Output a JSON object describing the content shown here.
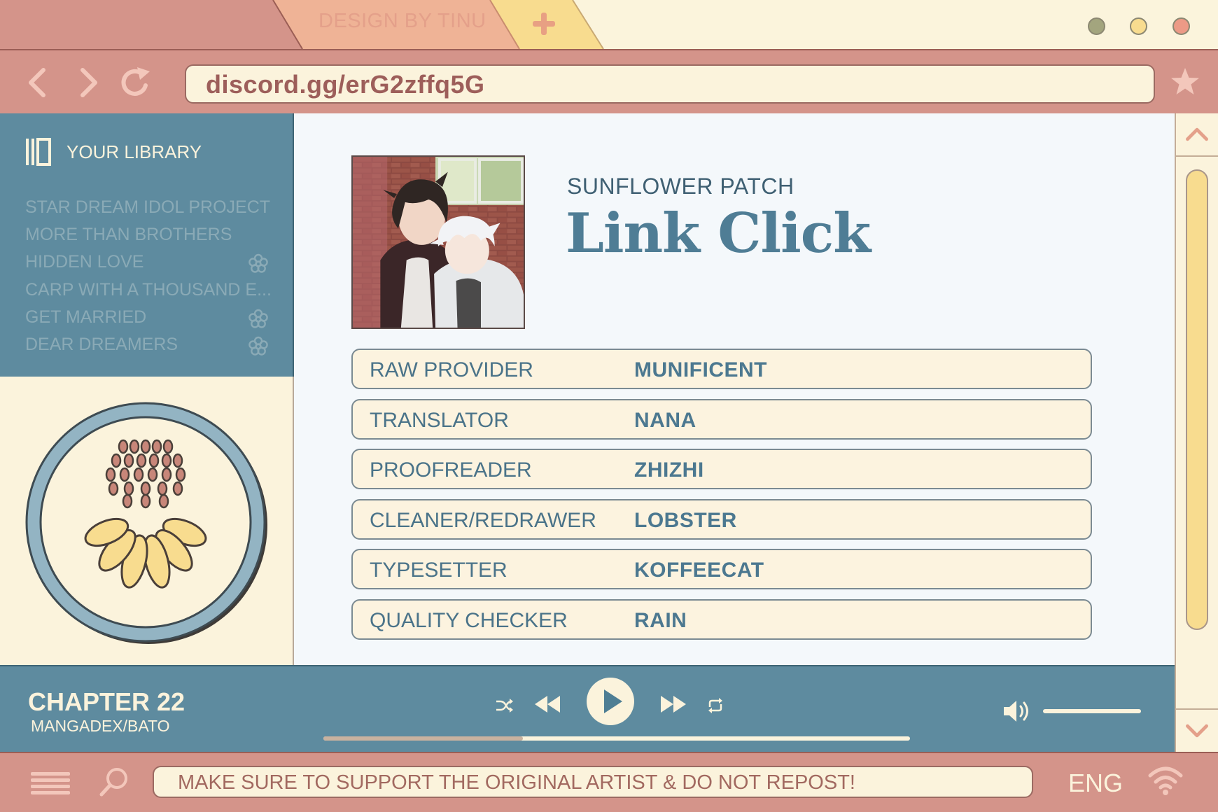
{
  "tab": {
    "label": "DESIGN BY TINU"
  },
  "address_bar": {
    "url": "discord.gg/erG2zffq5G"
  },
  "sidebar": {
    "header": "YOUR LIBRARY",
    "items": [
      {
        "label": "STAR DREAM IDOL PROJECT",
        "icon": ""
      },
      {
        "label": "MORE THAN BROTHERS",
        "icon": ""
      },
      {
        "label": "HIDDEN LOVE",
        "icon": "flower-icon"
      },
      {
        "label": "CARP WITH A THOUSAND E...",
        "icon": ""
      },
      {
        "label": "GET MARRIED",
        "icon": "flower-icon"
      },
      {
        "label": "DEAR DREAMERS",
        "icon": "flower-icon"
      }
    ]
  },
  "main": {
    "group": "SUNFLOWER PATCH",
    "title": "Link Click",
    "credits": [
      {
        "role": "RAW PROVIDER",
        "name": "MUNIFICENT"
      },
      {
        "role": "TRANSLATOR",
        "name": "NANA"
      },
      {
        "role": "PROOFREADER",
        "name": "ZHIZHI"
      },
      {
        "role": "CLEANER/REDRAWER",
        "name": "LOBSTER"
      },
      {
        "role": "TYPESETTER",
        "name": "KOFFEECAT"
      },
      {
        "role": "QUALITY CHECKER",
        "name": "RAIN"
      }
    ]
  },
  "player": {
    "chapter": "CHAPTER 22",
    "source": "MANGADEX/BATO",
    "progress": 0.34,
    "volume": 1.0
  },
  "bottom": {
    "notice": "MAKE SURE TO SUPPORT THE ORIGINAL ARTIST & DO NOT REPOST!",
    "language": "ENG"
  },
  "colors": {
    "frame": "#d4948a",
    "cream": "#fbf3dc",
    "teal": "#5e8b9f",
    "accent_yellow": "#f8dc8f",
    "accent_peach": "#efb396",
    "text_teal": "#4f7d95",
    "text_rose": "#9d5e5a"
  }
}
